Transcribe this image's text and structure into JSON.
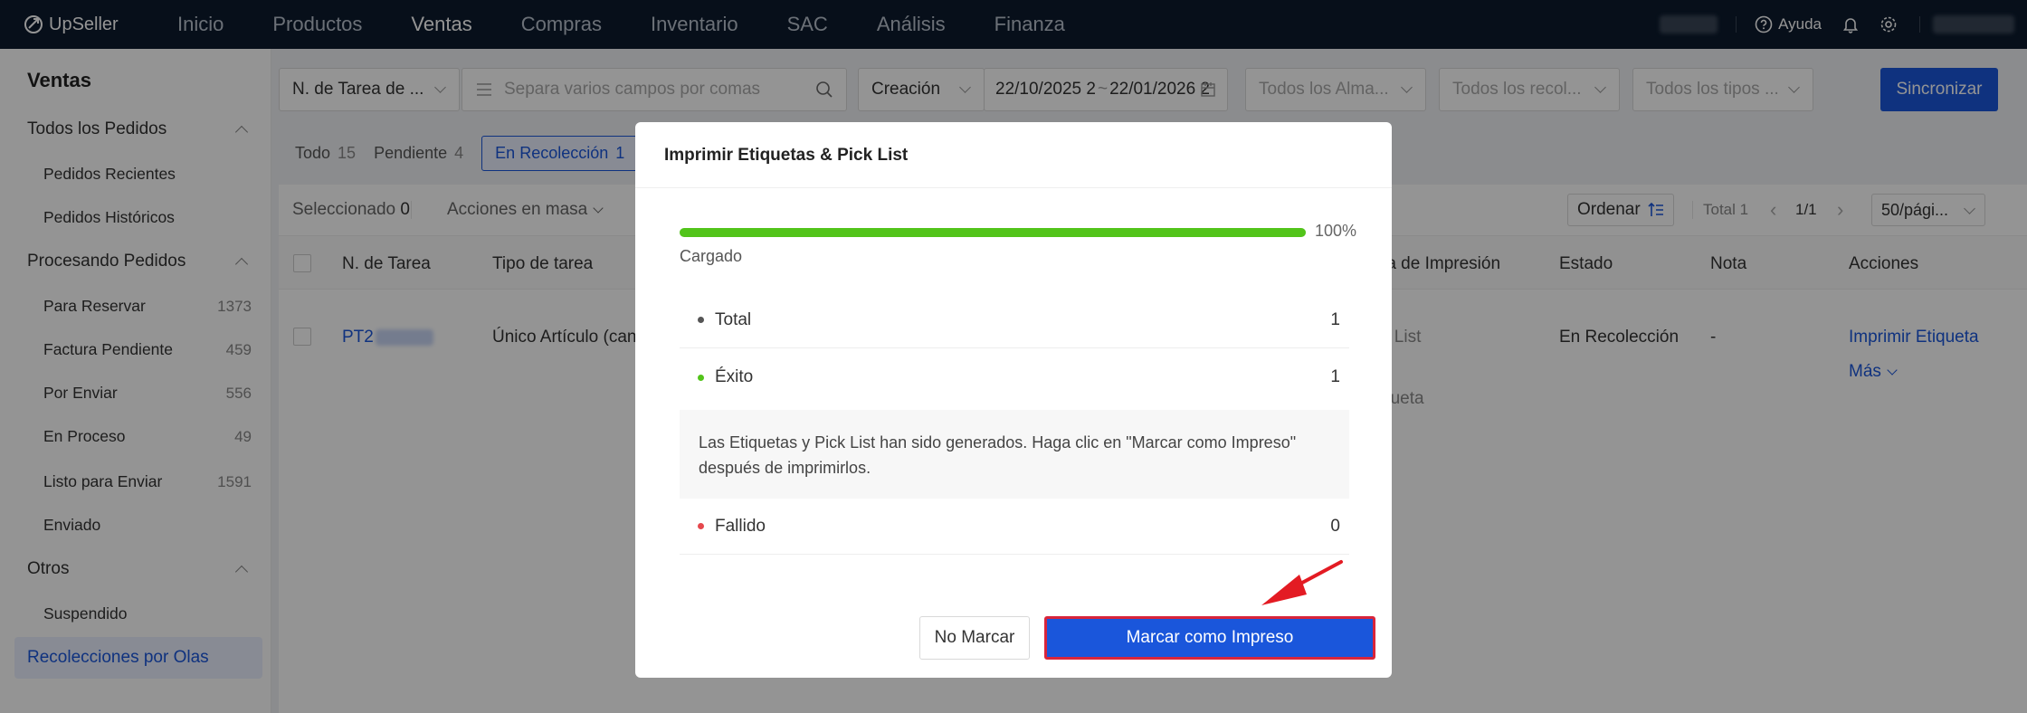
{
  "app": {
    "logo_text": "UpSeller"
  },
  "nav": {
    "items": [
      "Inicio",
      "Productos",
      "Ventas",
      "Compras",
      "Inventario",
      "SAC",
      "Análisis",
      "Finanza"
    ],
    "active_index": 2
  },
  "topbar": {
    "help_label": "Ayuda"
  },
  "sidebar": {
    "title": "Ventas",
    "groups": [
      {
        "label": "Todos los Pedidos",
        "items": [
          {
            "label": "Pedidos Recientes",
            "count": ""
          },
          {
            "label": "Pedidos Históricos",
            "count": ""
          }
        ]
      },
      {
        "label": "Procesando Pedidos",
        "items": [
          {
            "label": "Para Reservar",
            "count": "1373"
          },
          {
            "label": "Factura Pendiente",
            "count": "459"
          },
          {
            "label": "Por Enviar",
            "count": "556"
          },
          {
            "label": "En Proceso",
            "count": "49"
          },
          {
            "label": "Listo para Enviar",
            "count": "1591"
          },
          {
            "label": "Enviado",
            "count": ""
          }
        ]
      },
      {
        "label": "Otros",
        "items": [
          {
            "label": "Suspendido",
            "count": ""
          }
        ]
      }
    ],
    "active_item": "Recolecciones por Olas"
  },
  "filters": {
    "task_field": "N. de Tarea de ...",
    "search_placeholder": "Separa varios campos por comas",
    "date_type": "Creación",
    "date_start": "22/10/2025 2",
    "date_sep": "~",
    "date_end": "22/01/2026 2",
    "warehouse": "Todos los Alma...",
    "collector": "Todos los recol...",
    "types": "Todos los tipos ...",
    "sync_button": "Sincronizar"
  },
  "tabs": [
    {
      "label": "Todo",
      "count": "15"
    },
    {
      "label": "Pendiente",
      "count": "4"
    },
    {
      "label": "En Recolección",
      "count": "1"
    }
  ],
  "toolbar": {
    "selected_label": "Seleccionado",
    "selected_count": "0",
    "bulk_actions": "Acciones en masa",
    "sort_label": "Ordenar",
    "total_label": "Total 1",
    "page_indicator": "1/1",
    "page_size": "50/pági..."
  },
  "table": {
    "headers": [
      "N. de Tarea",
      "Tipo de tarea",
      "ra de Impresión",
      "Estado",
      "Nota",
      "Acciones"
    ],
    "rows": [
      {
        "task_id": "PT2",
        "task_type": "Único Artículo (can",
        "print_a": "k List",
        "print_b": "queta",
        "status": "En Recolección",
        "note": "-",
        "action_print": "Imprimir Etiqueta",
        "action_more": "Más"
      }
    ]
  },
  "modal": {
    "title": "Imprimir Etiquetas & Pick List",
    "progress_percent": 100,
    "progress_label": "100%",
    "loaded_label": "Cargado",
    "total_label": "Total",
    "total_value": "1",
    "success_label": "Éxito",
    "success_value": "1",
    "message": "Las Etiquetas y Pick List han sido generados. Haga clic en \"Marcar como Impreso\" después de imprimirlos.",
    "failed_label": "Fallido",
    "failed_value": "0",
    "no_mark_button": "No Marcar",
    "mark_button": "Marcar como Impreso"
  },
  "colors": {
    "primary": "#1a56db",
    "success": "#52c41a",
    "danger": "#e5484d",
    "topbar": "#0d1b2e",
    "highlight": "#d8253b"
  }
}
